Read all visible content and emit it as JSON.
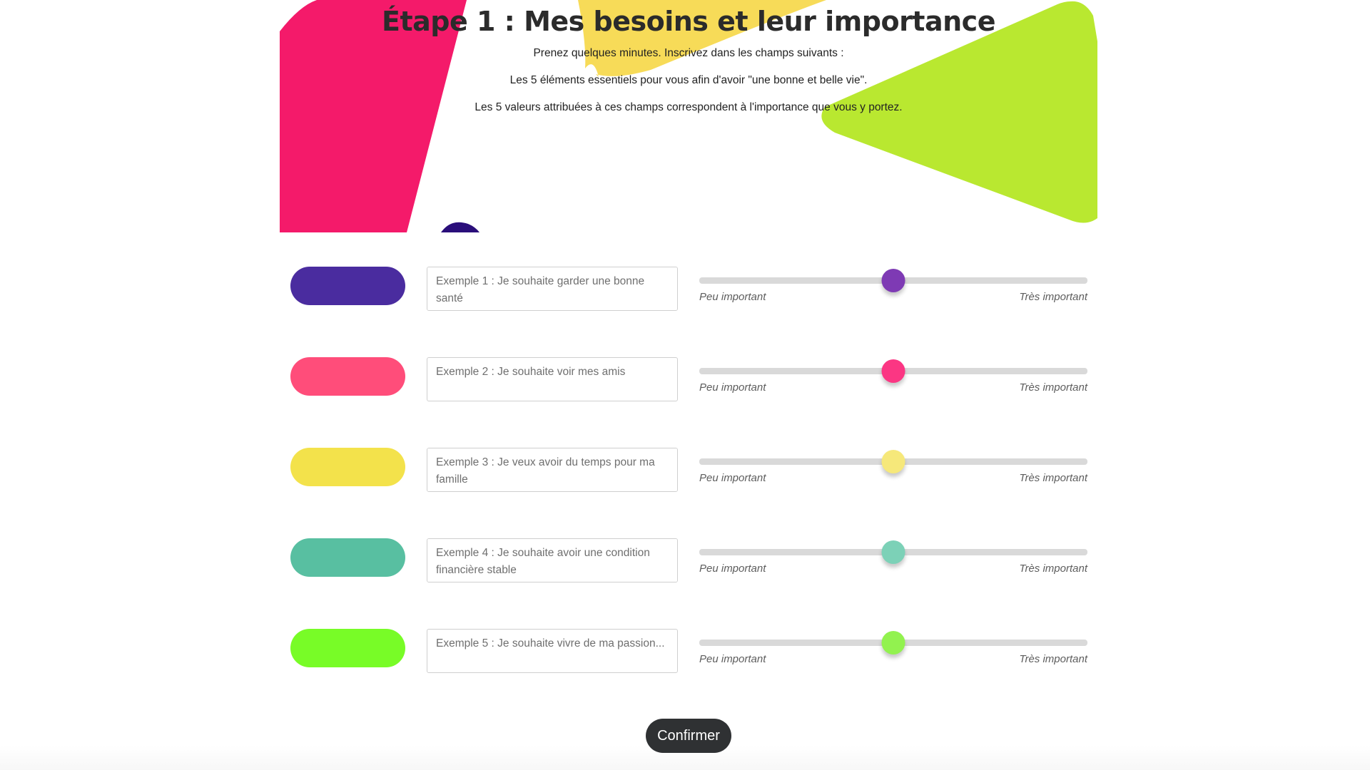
{
  "page": {
    "title": "Étape 1 : Mes besoins et leur importance",
    "intro": [
      "Prenez quelques minutes. Inscrivez dans les champs suivants :",
      "Les 5 éléments essentiels pour vous afin d'avoir \"une bonne et belle vie\".",
      "Les 5 valeurs attribuées à ces champs correspondent à l'importance que vous y portez."
    ]
  },
  "colors": {
    "hero_pink": "#f41a6a",
    "hero_yellow": "#f7db58",
    "hero_green": "#b9e830",
    "hero_dot": "#2a0e7a",
    "track": "#d9d9d9",
    "button": "#2f3133"
  },
  "needs": [
    {
      "color": "#4a2c9f",
      "thumb_color": "#7e3ab4",
      "placeholder": "Exemple 1 : Je souhaite garder une bonne santé",
      "value": "",
      "importance": 0.5,
      "label_min": "Peu important",
      "label_max": "Très important"
    },
    {
      "color": "#ff4d7a",
      "thumb_color": "#fb3683",
      "placeholder": "Exemple 2 : Je souhaite voir mes amis",
      "value": "",
      "importance": 0.5,
      "label_min": "Peu important",
      "label_max": "Très important"
    },
    {
      "color": "#f3e24b",
      "thumb_color": "#f6e87a",
      "placeholder": "Exemple 3 : Je veux avoir du temps pour ma famille",
      "value": "",
      "importance": 0.5,
      "label_min": "Peu important",
      "label_max": "Très important"
    },
    {
      "color": "#58bfa1",
      "thumb_color": "#7cd1b7",
      "placeholder": "Exemple 4 : Je souhaite avoir une condition financière stable",
      "value": "",
      "importance": 0.5,
      "label_min": "Peu important",
      "label_max": "Très important"
    },
    {
      "color": "#78fc27",
      "thumb_color": "#92f24f",
      "placeholder": "Exemple 5 : Je souhaite vivre de ma passion...",
      "value": "",
      "importance": 0.5,
      "label_min": "Peu important",
      "label_max": "Très important"
    }
  ],
  "confirm_label": "Confirmer"
}
